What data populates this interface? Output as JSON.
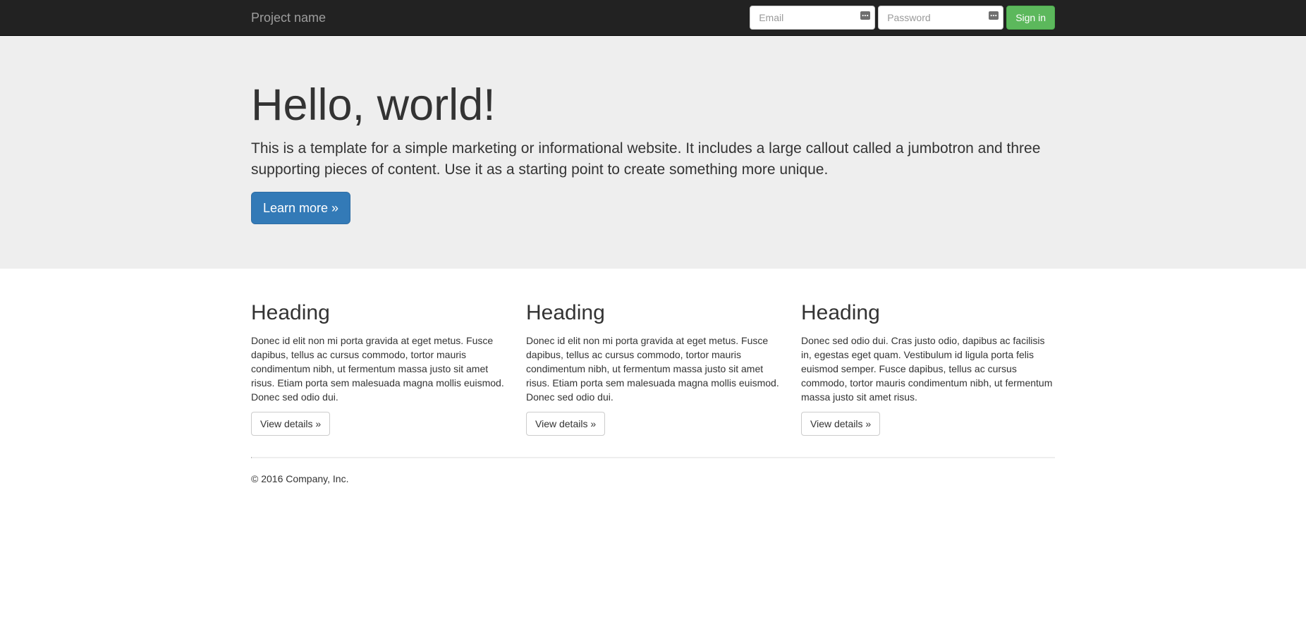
{
  "navbar": {
    "brand": "Project name",
    "email": {
      "placeholder": "Email",
      "value": ""
    },
    "password": {
      "placeholder": "Password",
      "value": ""
    },
    "signin_label": "Sign in",
    "colors": {
      "background": "#222222",
      "signin": "#5cb85c"
    }
  },
  "jumbotron": {
    "title": "Hello, world!",
    "text": "This is a template for a simple marketing or informational website. It includes a large callout called a jumbotron and three supporting pieces of content. Use it as a starting point to create something more unique.",
    "button_label": "Learn more »",
    "colors": {
      "background": "#eeeeee",
      "button": "#337ab7"
    }
  },
  "columns": [
    {
      "heading": "Heading",
      "text": "Donec id elit non mi porta gravida at eget metus. Fusce dapibus, tellus ac cursus commodo, tortor mauris condimentum nibh, ut fermentum massa justo sit amet risus. Etiam porta sem malesuada magna mollis euismod. Donec sed odio dui.",
      "button_label": "View details »"
    },
    {
      "heading": "Heading",
      "text": "Donec id elit non mi porta gravida at eget metus. Fusce dapibus, tellus ac cursus commodo, tortor mauris condimentum nibh, ut fermentum massa justo sit amet risus. Etiam porta sem malesuada magna mollis euismod. Donec sed odio dui.",
      "button_label": "View details »"
    },
    {
      "heading": "Heading",
      "text": "Donec sed odio dui. Cras justo odio, dapibus ac facilisis in, egestas eget quam. Vestibulum id ligula porta felis euismod semper. Fusce dapibus, tellus ac cursus commodo, tortor mauris condimentum nibh, ut fermentum massa justo sit amet risus.",
      "button_label": "View details »"
    }
  ],
  "footer": {
    "text": "© 2016 Company, Inc."
  },
  "icons": {
    "email_field": "password-manager-key-icon",
    "password_field": "password-manager-key-icon"
  }
}
